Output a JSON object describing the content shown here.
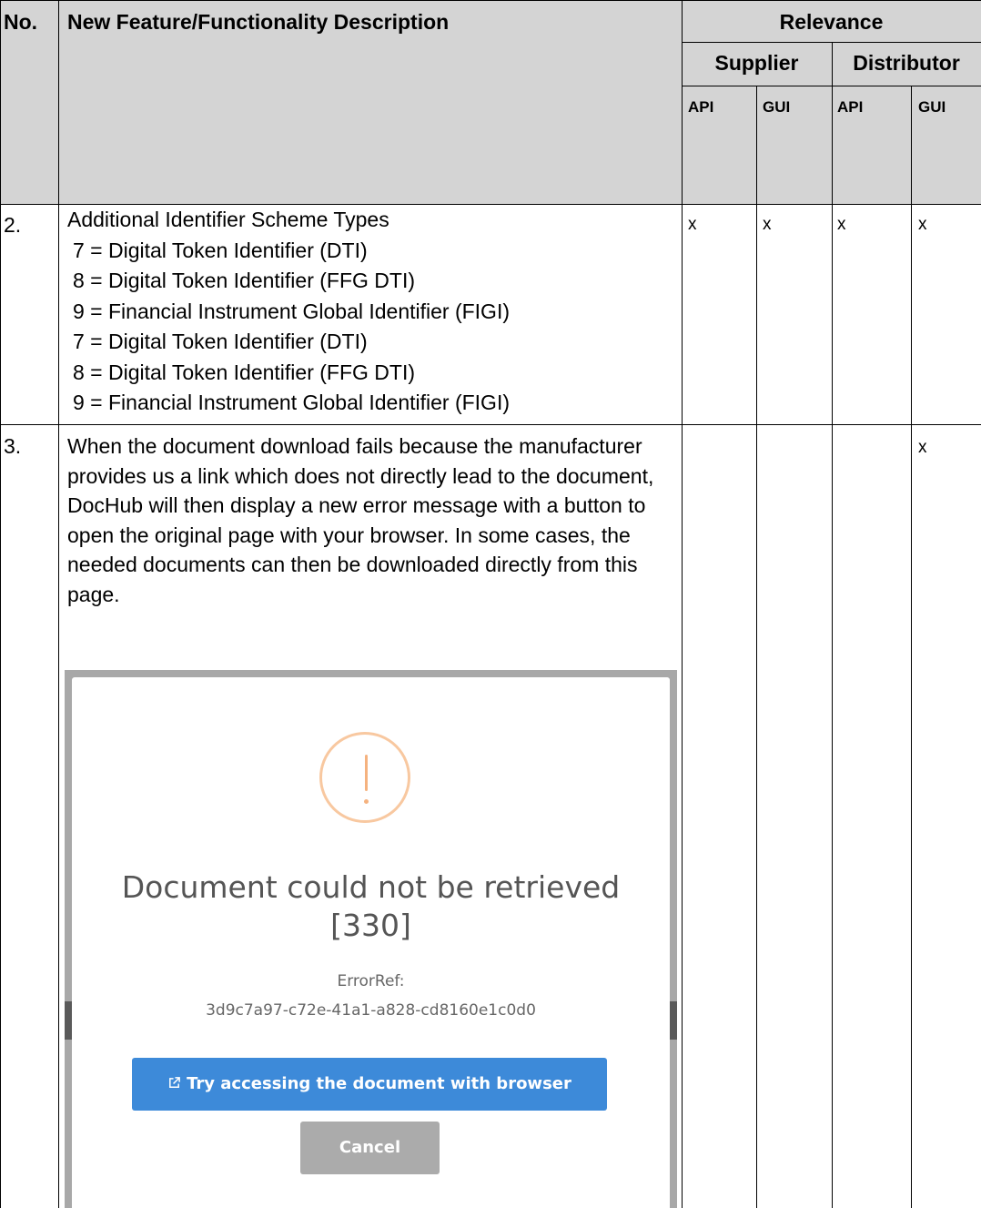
{
  "table": {
    "headers": {
      "no": "No.",
      "description": "New Feature/Functionality Description",
      "relevance": "Relevance",
      "supplier": "Supplier",
      "distributor": "Distributor",
      "supplier_api": "API",
      "supplier_gui": "GUI",
      "distributor_api": "API",
      "distributor_gui": "GUI"
    },
    "rows": [
      {
        "no": "2.",
        "title": "Additional Identifier Scheme Types",
        "lines": [
          "7 = Digital Token Identifier (DTI)",
          "8 = Digital Token Identifier (FFG DTI)",
          "9 = Financial Instrument Global Identifier (FIGI)",
          "7 = Digital Token Identifier (DTI)",
          "8 = Digital Token Identifier (FFG DTI)",
          "9 = Financial Instrument Global Identifier (FIGI)"
        ],
        "supplier_api": "x",
        "supplier_gui": "x",
        "distributor_api": "x",
        "distributor_gui": "x"
      },
      {
        "no": "3.",
        "description": "When the document download fails because the manufacturer provides us a link which does not directly lead to the document, DocHub will then display a new error message with a button to open the original page with your browser. In some cases, the needed documents can then be downloaded directly from this page.",
        "supplier_api": "",
        "supplier_gui": "",
        "distributor_api": "",
        "distributor_gui": "x"
      }
    ]
  },
  "dialog": {
    "icon": "warning-exclamation-icon",
    "title_line1": "Document could not be retrieved",
    "title_line2": "[330]",
    "error_ref_label": "ErrorRef:",
    "error_ref_value": "3d9c7a97-c72e-41a1-a828-cd8160e1c0d0",
    "primary_button_icon": "external-link-icon",
    "primary_button_label": "Try accessing the document with browser",
    "cancel_button_label": "Cancel",
    "colors": {
      "primary": "#3d8ad9",
      "cancel": "#ababab",
      "warning": "#f5b27f"
    }
  }
}
